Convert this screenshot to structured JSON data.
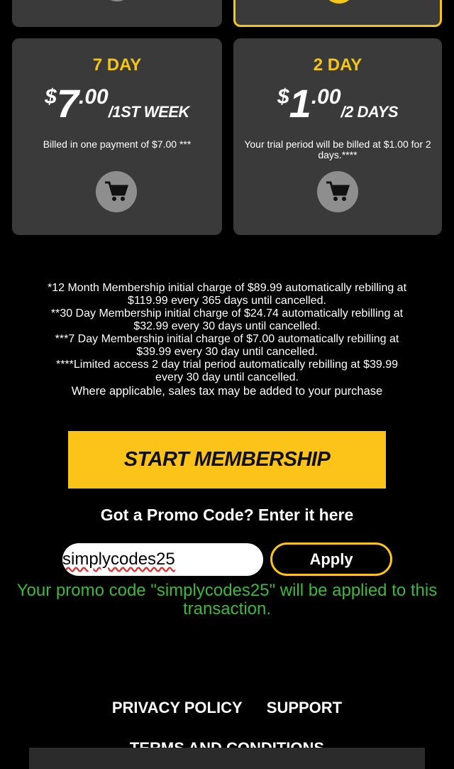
{
  "plans": [
    {
      "name": "7 DAY",
      "currency": "$",
      "price_int": "7",
      "price_dec": ".00",
      "period": "/1ST WEEK",
      "description": "Billed in one payment of $7.00 ***"
    },
    {
      "name": "2 DAY",
      "currency": "$",
      "price_int": "1",
      "price_dec": ".00",
      "period": "/2 DAYS",
      "description": "Your trial period will be billed at $1.00 for 2 days.****"
    }
  ],
  "terms": {
    "line1": "*12 Month Membership initial charge of $89.99 automatically rebilling at",
    "line2": "$119.99 every 365 days until cancelled.",
    "line3": "**30 Day Membership initial charge of $24.74 automatically rebilling at",
    "line4": "$32.99 every 30 days until cancelled.",
    "line5": "***7 Day Membership initial charge of $7.00 automatically rebilling at",
    "line6": "$39.99 every 30 day until cancelled.",
    "line7": "****Limited access 2 day trial period automatically rebilling at $39.99",
    "line8": "every 30 day until cancelled.",
    "line9": "Where applicable, sales tax may be added to your purchase"
  },
  "cta": {
    "start_label": "START MEMBERSHIP"
  },
  "promo": {
    "label": "Got a Promo Code? Enter it here",
    "value": "simplycodes25",
    "apply_label": "Apply",
    "message": "Your promo code \"simplycodes25\" will be applied to this transaction."
  },
  "footer": {
    "privacy": "PRIVACY POLICY",
    "support": "SUPPORT",
    "terms": "TERMS AND CONDITIONS"
  },
  "colors": {
    "accent": "#fcc419",
    "card_bg": "#3a3a3a",
    "success": "#3db83d"
  }
}
